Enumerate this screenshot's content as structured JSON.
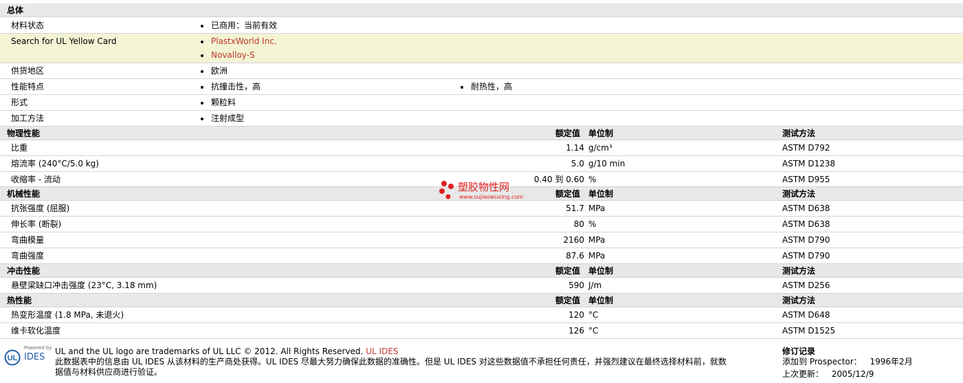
{
  "general": {
    "title": "总体",
    "material_status": {
      "label": "材料状态",
      "value": "已商用：当前有效"
    },
    "yellow_card": {
      "label": "Search for UL Yellow Card",
      "links": [
        "PlastxWorld Inc.",
        "Novalloy-S"
      ]
    },
    "supply_region": {
      "label": "供货地区",
      "value": "欧洲"
    },
    "features": {
      "label": "性能特点",
      "values": [
        "抗撞击性，高",
        "耐热性，高"
      ]
    },
    "form": {
      "label": "形式",
      "value": "颗粒料"
    },
    "processing": {
      "label": "加工方法",
      "value": "注射成型"
    }
  },
  "columns": {
    "nominal": "额定值",
    "unit": "单位制",
    "test": "测试方法"
  },
  "sections": [
    {
      "title": "物理性能",
      "rows": [
        {
          "name": "比重",
          "value": "1.14",
          "unit": "g/cm³",
          "test": "ASTM D792"
        },
        {
          "name": "熔流率  (240°C/5.0 kg)",
          "value": "5.0",
          "unit": "g/10 min",
          "test": "ASTM D1238"
        },
        {
          "name": "收缩率  - 流动",
          "value": "0.40 到  0.60",
          "unit": "%",
          "test": "ASTM D955"
        }
      ]
    },
    {
      "title": "机械性能",
      "rows": [
        {
          "name": "抗张强度  (屈服)",
          "value": "51.7",
          "unit": "MPa",
          "test": "ASTM D638"
        },
        {
          "name": "伸长率  (断裂)",
          "value": "80",
          "unit": "%",
          "test": "ASTM D638"
        },
        {
          "name": "弯曲模量",
          "value": "2160",
          "unit": "MPa",
          "test": "ASTM D790"
        },
        {
          "name": "弯曲强度",
          "value": "87.6",
          "unit": "MPa",
          "test": "ASTM D790"
        }
      ]
    },
    {
      "title": "冲击性能",
      "rows": [
        {
          "name": "悬壁梁缺口冲击强度  (23°C, 3.18 mm)",
          "value": "590",
          "unit": "J/m",
          "test": "ASTM D256"
        }
      ]
    },
    {
      "title": "热性能",
      "rows": [
        {
          "name": "热变形温度  (1.8 MPa, 未退火)",
          "value": "120",
          "unit": "°C",
          "test": "ASTM D648"
        },
        {
          "name": "维卡软化温度",
          "value": "126",
          "unit": "°C",
          "test": "ASTM D1525"
        }
      ]
    }
  ],
  "watermark": {
    "name": "塑胶物性网",
    "url": "www.sujiaowuxing.com"
  },
  "footer": {
    "powered_by": "Powered by",
    "ides": "IDES",
    "trademark": "UL and the UL logo are trademarks of UL LLC © 2012. All Rights Reserved.",
    "trademark_link": "UL IDES",
    "disclaimer_1": "此数据表中的信息由  UL IDES 从该材料的生产商处获得。UL IDES 尽最大努力确保此数据的准确性。但是  UL IDES 对这些数据值不承担任何责任，并强烈建议在最终选择材料前，就数",
    "disclaimer_2": "据值与材料供应商进行验证。",
    "revision_title": "修订记录",
    "added_label": "添加到  Prospector：",
    "added_value": "1996年2月",
    "updated_label": "上次更新：",
    "updated_value": "2005/12/9"
  },
  "colors": {
    "link": "#c0362c",
    "section_bg": "#e8e8e8",
    "highlight_bg": "#f2f4d4",
    "ul_blue": "#1f5ea8",
    "watermark_red": "#e02020"
  }
}
